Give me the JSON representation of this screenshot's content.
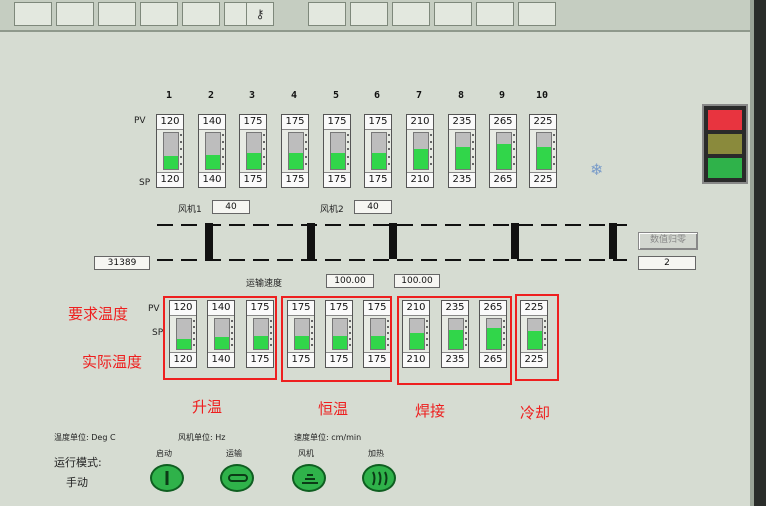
{
  "toolbar": {
    "tool_count": 12
  },
  "zones_top": [
    {
      "num": "1",
      "pv": "120",
      "sp": "120",
      "fill": 0.35
    },
    {
      "num": "2",
      "pv": "140",
      "sp": "140",
      "fill": 0.4
    },
    {
      "num": "3",
      "pv": "175",
      "sp": "175",
      "fill": 0.45
    },
    {
      "num": "4",
      "pv": "175",
      "sp": "175",
      "fill": 0.45
    },
    {
      "num": "5",
      "pv": "175",
      "sp": "175",
      "fill": 0.45
    },
    {
      "num": "6",
      "pv": "175",
      "sp": "175",
      "fill": 0.45
    },
    {
      "num": "7",
      "pv": "210",
      "sp": "210",
      "fill": 0.55
    },
    {
      "num": "8",
      "pv": "235",
      "sp": "235",
      "fill": 0.62
    },
    {
      "num": "9",
      "pv": "265",
      "sp": "265",
      "fill": 0.7
    },
    {
      "num": "10",
      "pv": "225",
      "sp": "225",
      "fill": 0.6
    }
  ],
  "labels": {
    "pv": "PV",
    "sp": "SP",
    "fan1": "风机1",
    "fan1_value": "40",
    "fan2": "风机2",
    "fan2_value": "40",
    "counter_value": "31389",
    "conveyor_speed": "运输速度",
    "speed_set": "100.00",
    "speed_actual": "100.00",
    "reset_button": "数值归零",
    "reset_value": "2",
    "temp_unit": "温度单位: Deg C",
    "fan_unit": "风机单位: Hz",
    "speed_unit": "速度单位: cm/min",
    "run_mode": "运行模式:",
    "manual": "手动",
    "ctrl_start": "启动",
    "ctrl_convey": "运输",
    "ctrl_fan": "风机",
    "ctrl_heat": "加热"
  },
  "zones_bottom": [
    {
      "pv": "120",
      "sp": "120",
      "fill": 0.35
    },
    {
      "pv": "140",
      "sp": "140",
      "fill": 0.4
    },
    {
      "pv": "175",
      "sp": "175",
      "fill": 0.45
    },
    {
      "pv": "175",
      "sp": "175",
      "fill": 0.45
    },
    {
      "pv": "175",
      "sp": "175",
      "fill": 0.45
    },
    {
      "pv": "175",
      "sp": "175",
      "fill": 0.45
    },
    {
      "pv": "210",
      "sp": "210",
      "fill": 0.55
    },
    {
      "pv": "235",
      "sp": "235",
      "fill": 0.62
    },
    {
      "pv": "265",
      "sp": "265",
      "fill": 0.7
    },
    {
      "pv": "225",
      "sp": "225",
      "fill": 0.6
    }
  ],
  "annotations": {
    "required_temp": "要求温度",
    "actual_temp": "实际温度",
    "heat_up": "升温",
    "constant": "恒温",
    "solder": "焊接",
    "cool": "冷却"
  },
  "signal_light": {
    "top": "#e8343f",
    "middle": "#8a8a3c",
    "bottom": "#2fb24a"
  }
}
